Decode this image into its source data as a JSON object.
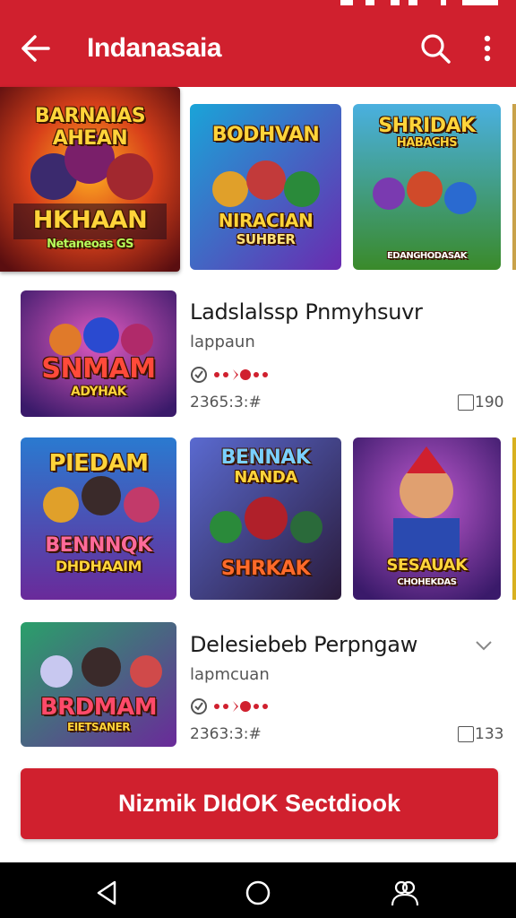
{
  "colors": {
    "brand": "#d0202e",
    "navbar": "#000000"
  },
  "appbar": {
    "title": "Indanasaia",
    "back_icon": "arrow-left-icon",
    "search_icon": "search-icon",
    "more_icon": "more-vertical-icon"
  },
  "featured_row": [
    {
      "title": "BARNAIAS AHEAN",
      "subtitle": "HKHAAN",
      "caption": "Netaneoas GS"
    },
    {
      "title": "BODHVAN",
      "subtitle": "NIRACIAN",
      "caption": "SUHBER"
    },
    {
      "title": "SHRIDAK",
      "subtitle": "HABACHS",
      "caption": "EDANGHODASAK"
    }
  ],
  "list_item_1": {
    "title": "Ladslalssp Pnmyhsuvr",
    "subtitle": "lappaun",
    "meta": "2365:3:#",
    "count": "190",
    "thumb_title": "SNMAM",
    "thumb_sub": "ADYHAK"
  },
  "second_row": [
    {
      "title": "PIEDAM",
      "subtitle": "BENNNQK",
      "caption": "DHDHAAIM"
    },
    {
      "title": "BENNAK",
      "subtitle": "NANDA",
      "caption": "SHRKAK"
    },
    {
      "title": "SESAUAK",
      "subtitle": "CHOHEKDAS",
      "caption": ""
    }
  ],
  "list_item_2": {
    "title": "Delesiebeb Perpngaw",
    "subtitle": "lapmcuan",
    "meta": "2363:3:#",
    "count": "133",
    "thumb_title": "BRDMAM",
    "thumb_sub": "EIETSANER"
  },
  "cta": {
    "label": "Nizmik DIdOK Sectdiook"
  },
  "navbar": {
    "back_icon": "triangle-back-icon",
    "home_icon": "circle-home-icon",
    "recents_icon": "people-icon"
  }
}
